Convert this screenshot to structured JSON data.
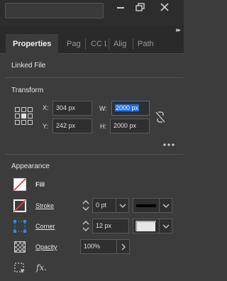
{
  "tabs": [
    {
      "label": "Properties"
    },
    {
      "label": "Pag"
    },
    {
      "label": "CC L"
    },
    {
      "label": "Alig"
    },
    {
      "label": "Path"
    }
  ],
  "linked_file": {
    "label": "Linked File"
  },
  "transform": {
    "title": "Transform",
    "x_label": "X:",
    "x_value": "304 px",
    "y_label": "Y:",
    "y_value": "242 px",
    "w_label": "W:",
    "w_value": "2000 px",
    "h_label": "H:",
    "h_value": "2000 px"
  },
  "appearance": {
    "title": "Appearance",
    "fill_label": "Fill",
    "stroke_label": "Stroke",
    "stroke_value": "0 pt",
    "corner_label": "Corner",
    "corner_value": "12 px",
    "opacity_label": "Opacity",
    "opacity_value": "100%",
    "fx_label": "fx."
  },
  "colors": {
    "accent": "#2d6cd0",
    "no_fill_red": "#e04040",
    "panel_bg": "#3c3c3c"
  },
  "icons": [
    "minimize-icon",
    "restore-icon",
    "close-icon",
    "collapse-panel-icon",
    "reference-point-icon",
    "constrain-proportions-icon",
    "more-options-icon",
    "fill-swatch-icon",
    "stroke-swatch-icon",
    "corner-icon",
    "opacity-icon",
    "chevron-up-icon",
    "chevron-down-icon",
    "chevron-right-icon",
    "selection-icon",
    "fx-icon"
  ]
}
